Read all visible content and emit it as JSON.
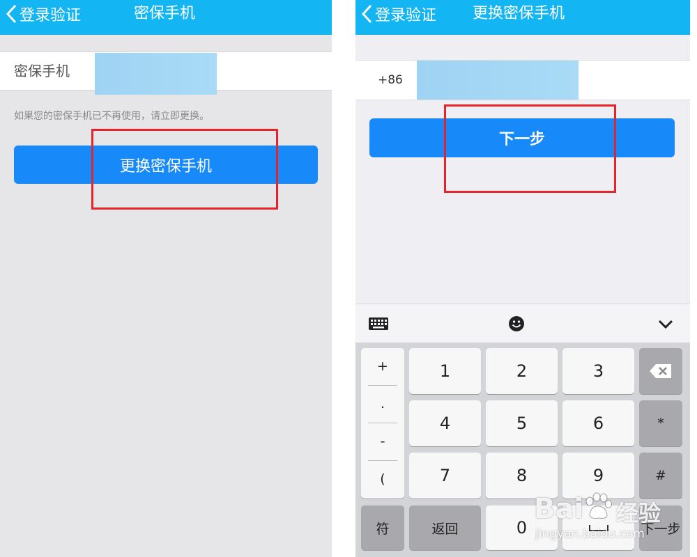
{
  "left": {
    "nav": {
      "back_label": "登录验证",
      "title": "密保手机"
    },
    "phone_label": "密保手机",
    "hint": "如果您的密保手机已不再使用，请立即更换。",
    "button_label": "更换密保手机"
  },
  "right": {
    "nav": {
      "back_label": "登录验证",
      "title": "更换密保手机"
    },
    "country_code": "+86",
    "next_label": "下一步",
    "keyboard": {
      "symbols": [
        "+",
        ".",
        "-",
        "("
      ],
      "digits": [
        "1",
        "2",
        "3",
        "4",
        "5",
        "6",
        "7",
        "8",
        "9",
        "0"
      ],
      "star": "*",
      "hash": "#",
      "fu": "符",
      "back": "返回",
      "next": "下一步"
    }
  },
  "watermark": {
    "brand": "Bai",
    "brand2": "经验",
    "url": "jingyan.baidu.com"
  },
  "colors": {
    "navbar": "#13b6f2",
    "button": "#1789f8",
    "highlight": "#e4232a"
  }
}
